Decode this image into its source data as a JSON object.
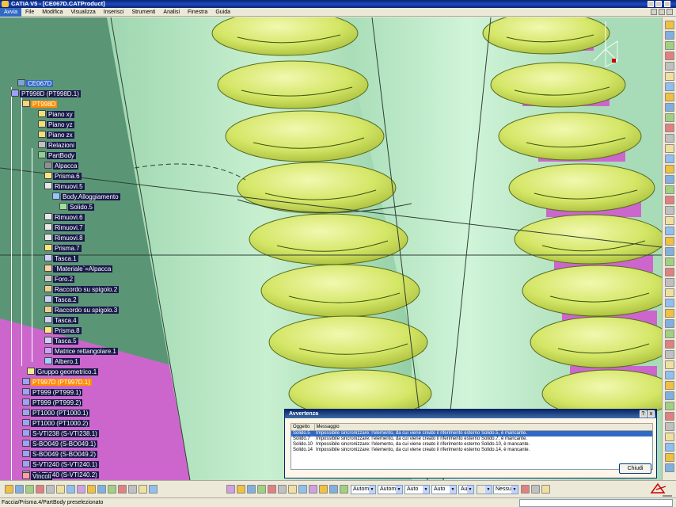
{
  "window": {
    "title": "CATIA V5 - [CE067D.CATProduct]"
  },
  "menubar": {
    "items": [
      "Avvia",
      "File",
      "Modifica",
      "Visualizza",
      "Inserisci",
      "Strumenti",
      "Analisi",
      "Finestra",
      "Guida"
    ],
    "active_index": 0
  },
  "tree": {
    "nodes": [
      {
        "label": "CE067D",
        "style": "sel",
        "icon": "product-icon"
      },
      {
        "label": "PT998D (PT998D.1)",
        "style": "",
        "icon": "component-icon"
      },
      {
        "label": "PT998D",
        "style": "hi",
        "icon": "part-icon"
      },
      {
        "label": "Piano xy",
        "style": "",
        "icon": "plane-icon"
      },
      {
        "label": "Piano yz",
        "style": "",
        "icon": "plane-icon"
      },
      {
        "label": "Piano zx",
        "style": "",
        "icon": "plane-icon"
      },
      {
        "label": "Relazioni",
        "style": "",
        "icon": "relations-icon"
      },
      {
        "label": "PartBody",
        "style": "",
        "icon": "partbody-icon"
      },
      {
        "label": "Alpacca",
        "style": "",
        "icon": "material-icon"
      },
      {
        "label": "Prisma.6",
        "style": "",
        "icon": "prism-icon"
      },
      {
        "label": "Rimuovi.5",
        "style": "",
        "icon": "remove-icon"
      },
      {
        "label": "Body.Alloggiamento",
        "style": "",
        "icon": "body-icon"
      },
      {
        "label": "Solido.5",
        "style": "",
        "icon": "solid-icon"
      },
      {
        "label": "Rimuovi.6",
        "style": "",
        "icon": "remove-icon"
      },
      {
        "label": "Rimuovi.7",
        "style": "",
        "icon": "remove-icon"
      },
      {
        "label": "Rimuovi.8",
        "style": "",
        "icon": "remove-icon"
      },
      {
        "label": "Prisma.7",
        "style": "",
        "icon": "prism-icon"
      },
      {
        "label": "Tasca.1",
        "style": "",
        "icon": "pocket-icon"
      },
      {
        "label": "`Materiale`=Alpacca",
        "style": "",
        "icon": "formula-icon"
      },
      {
        "label": "Foro.2",
        "style": "",
        "icon": "hole-icon"
      },
      {
        "label": "Raccordo su spigolo.2",
        "style": "",
        "icon": "fillet-icon"
      },
      {
        "label": "Tasca.2",
        "style": "",
        "icon": "pocket-icon"
      },
      {
        "label": "Raccordo su spigolo.3",
        "style": "",
        "icon": "fillet-icon"
      },
      {
        "label": "Tasca.4",
        "style": "",
        "icon": "pocket-icon"
      },
      {
        "label": "Prisma.8",
        "style": "",
        "icon": "prism-icon"
      },
      {
        "label": "Tasca.5",
        "style": "",
        "icon": "pocket-icon"
      },
      {
        "label": "Matrice rettangolare.1",
        "style": "",
        "icon": "pattern-icon"
      },
      {
        "label": "Albero.1",
        "style": "",
        "icon": "shaft-icon"
      },
      {
        "label": "Gruppo geometrico.1",
        "style": "",
        "icon": "geometric-set-icon"
      },
      {
        "label": "PT997D (PT997D.1)",
        "style": "hi",
        "icon": "component-icon"
      },
      {
        "label": "PT999 (PT999.1)",
        "style": "",
        "icon": "component-icon"
      },
      {
        "label": "PT999 (PT999.2)",
        "style": "",
        "icon": "component-icon"
      },
      {
        "label": "PT1000 (PT1000.1)",
        "style": "",
        "icon": "component-icon"
      },
      {
        "label": "PT1000 (PT1000.2)",
        "style": "",
        "icon": "component-icon"
      },
      {
        "label": "S-VTI238 (S-VTI238.1)",
        "style": "",
        "icon": "component-icon"
      },
      {
        "label": "S-BO049 (S-BO049.1)",
        "style": "",
        "icon": "component-icon"
      },
      {
        "label": "S-BO049 (S-BO049.2)",
        "style": "",
        "icon": "component-icon"
      },
      {
        "label": "S-VTI240 (S-VTI240.1)",
        "style": "",
        "icon": "component-icon"
      },
      {
        "label": "S-VTI240 (S-VTI240.2)",
        "style": "",
        "icon": "component-icon"
      },
      {
        "label": "Vincoli",
        "style": "",
        "icon": "constraints-icon"
      }
    ]
  },
  "dialog": {
    "title": "Avvertenza",
    "help_label": "?",
    "close_label": "x",
    "columns": [
      "Oggetto",
      "Messaggio"
    ],
    "rows": [
      {
        "object": "Solido.5",
        "message": "Impossibile sincronizzare: l'elemento, da cui viene creato il riferimento esterno Solido.5, è mancante."
      },
      {
        "object": "Solido.7",
        "message": "Impossibile sincronizzare: l'elemento, da cui viene creato il riferimento esterno Solido.7, è mancante."
      },
      {
        "object": "Solido.10",
        "message": "Impossibile sincronizzare: l'elemento, da cui viene creato il riferimento esterno Solido.10, è mancante."
      },
      {
        "object": "Solido.14",
        "message": "Impossibile sincronizzare: l'elemento, da cui viene creato il riferimento esterno Solido.14, è mancante."
      }
    ],
    "selected_row": 0,
    "button_label": "Chiudi"
  },
  "bottom_toolbar": {
    "selects": [
      "Automa",
      "Automa",
      "Auto",
      "Auto",
      "Aut",
      "",
      "Nessuno"
    ]
  },
  "status": {
    "text": "Faccia/Prisma.4/PartBody preselezionato"
  },
  "colors": {
    "viewport_bg": "#4f8a6a",
    "spring": "#d6e86a",
    "cylinder": "#b8e8c4",
    "magenta": "#cc66cc",
    "tree_label_bg": "#1a1a4a",
    "selection": "#316ac5",
    "highlight": "#ff8c00"
  }
}
